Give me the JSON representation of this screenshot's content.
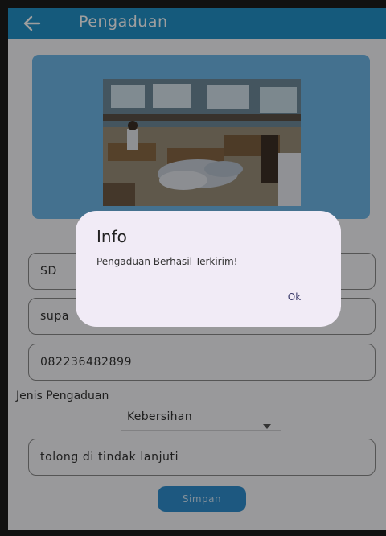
{
  "appbar": {
    "title": "Pengaduan",
    "back_icon": "arrow-left-icon"
  },
  "form": {
    "school_value": "SD",
    "name_value": "supa",
    "phone_value": "082236482899",
    "type_label": "Jenis Pengaduan",
    "type_selected": "Kebersihan",
    "description_value": "tolong di tindak lanjuti",
    "save_label": "Simpan"
  },
  "dialog": {
    "title": "Info",
    "message": "Pengaduan Berhasil Terkirim!",
    "ok_label": "Ok"
  },
  "colors": {
    "appbar": "#2392c9",
    "card": "#6fb7e7",
    "button": "#2f8fcf",
    "dialog": "#f1ebf6"
  }
}
